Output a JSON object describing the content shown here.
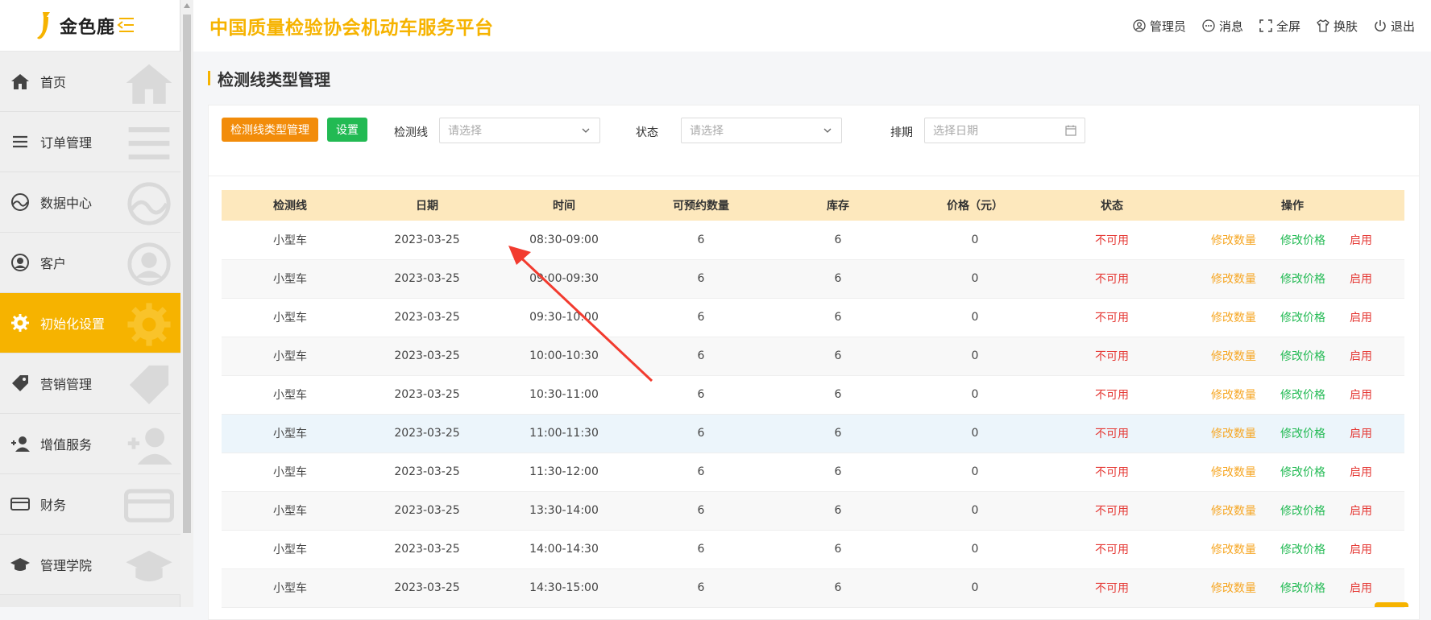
{
  "brand": {
    "name": "金色鹿"
  },
  "header": {
    "title": "中国质量检验协会机动车服务平台",
    "actions": [
      {
        "label": "管理员",
        "icon": "user-icon"
      },
      {
        "label": "消息",
        "icon": "message-icon"
      },
      {
        "label": "全屏",
        "icon": "fullscreen-icon"
      },
      {
        "label": "换肤",
        "icon": "shirt-icon"
      },
      {
        "label": "退出",
        "icon": "power-icon"
      }
    ]
  },
  "sidebar": {
    "items": [
      {
        "label": "首页",
        "icon": "home-icon",
        "active": false
      },
      {
        "label": "订单管理",
        "icon": "list-icon",
        "active": false
      },
      {
        "label": "数据中心",
        "icon": "chart-icon",
        "active": false
      },
      {
        "label": "客户",
        "icon": "user-icon",
        "active": false
      },
      {
        "label": "初始化设置",
        "icon": "gear-icon",
        "active": true
      },
      {
        "label": "营销管理",
        "icon": "tag-icon",
        "active": false
      },
      {
        "label": "增值服务",
        "icon": "add-user-icon",
        "active": false
      },
      {
        "label": "财务",
        "icon": "card-icon",
        "active": false
      },
      {
        "label": "管理学院",
        "icon": "graduation-icon",
        "active": false
      }
    ]
  },
  "page": {
    "title": "检测线类型管理"
  },
  "toolbar": {
    "type_button": "检测线类型管理",
    "settings_button": "设置",
    "filters": {
      "line_label": "检测线",
      "line_placeholder": "请选择",
      "status_label": "状态",
      "status_placeholder": "请选择",
      "schedule_label": "排期",
      "schedule_placeholder": "选择日期"
    }
  },
  "table": {
    "headers": [
      "检测线",
      "日期",
      "时间",
      "可预约数量",
      "库存",
      "价格（元）",
      "状态",
      "操作"
    ],
    "ops": {
      "qty": "修改数量",
      "price": "修改价格",
      "enable": "启用"
    },
    "rows": [
      {
        "line": "小型车",
        "date": "2023-03-25",
        "time": "08:30-09:00",
        "available": "6",
        "stock": "6",
        "price": "0",
        "status": "不可用"
      },
      {
        "line": "小型车",
        "date": "2023-03-25",
        "time": "09:00-09:30",
        "available": "6",
        "stock": "6",
        "price": "0",
        "status": "不可用"
      },
      {
        "line": "小型车",
        "date": "2023-03-25",
        "time": "09:30-10:00",
        "available": "6",
        "stock": "6",
        "price": "0",
        "status": "不可用"
      },
      {
        "line": "小型车",
        "date": "2023-03-25",
        "time": "10:00-10:30",
        "available": "6",
        "stock": "6",
        "price": "0",
        "status": "不可用"
      },
      {
        "line": "小型车",
        "date": "2023-03-25",
        "time": "10:30-11:00",
        "available": "6",
        "stock": "6",
        "price": "0",
        "status": "不可用"
      },
      {
        "line": "小型车",
        "date": "2023-03-25",
        "time": "11:00-11:30",
        "available": "6",
        "stock": "6",
        "price": "0",
        "status": "不可用"
      },
      {
        "line": "小型车",
        "date": "2023-03-25",
        "time": "11:30-12:00",
        "available": "6",
        "stock": "6",
        "price": "0",
        "status": "不可用"
      },
      {
        "line": "小型车",
        "date": "2023-03-25",
        "time": "13:30-14:00",
        "available": "6",
        "stock": "6",
        "price": "0",
        "status": "不可用"
      },
      {
        "line": "小型车",
        "date": "2023-03-25",
        "time": "14:00-14:30",
        "available": "6",
        "stock": "6",
        "price": "0",
        "status": "不可用"
      },
      {
        "line": "小型车",
        "date": "2023-03-25",
        "time": "14:30-15:00",
        "available": "6",
        "stock": "6",
        "price": "0",
        "status": "不可用"
      }
    ]
  },
  "colors": {
    "accent": "#f6b300",
    "orange_button": "#f28c0a",
    "green_button": "#22ba53",
    "danger": "#e53935",
    "table_header_bg": "#fde8bd"
  }
}
